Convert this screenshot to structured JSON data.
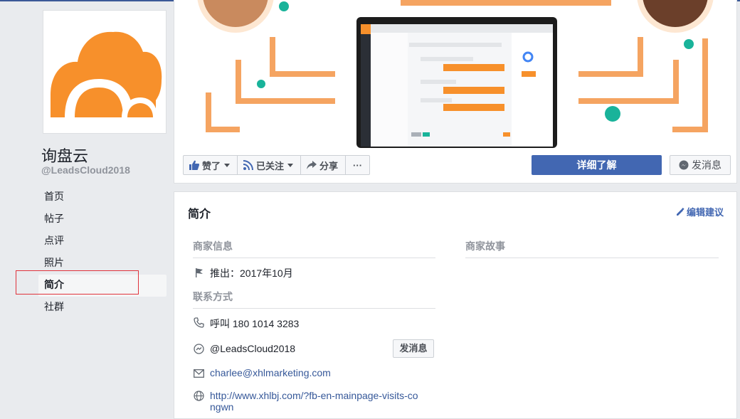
{
  "page": {
    "name": "询盘云",
    "handle": "@LeadsCloud2018"
  },
  "nav": [
    {
      "label": "首页"
    },
    {
      "label": "帖子"
    },
    {
      "label": "点评"
    },
    {
      "label": "照片"
    },
    {
      "label": "简介",
      "active": true
    },
    {
      "label": "社群"
    }
  ],
  "actions": {
    "like": "赞了",
    "follow": "已关注",
    "share": "分享",
    "more": "···",
    "learn_more": "详细了解",
    "message": "发消息"
  },
  "about": {
    "title": "简介",
    "edit": "编辑建议",
    "business_info": "商家信息",
    "launched": "推出：2017年10月",
    "contact": "联系方式",
    "phone": "呼叫 180 1014 3283",
    "messenger": "@LeadsCloud2018",
    "messenger_button": "发消息",
    "email": "charlee@xhlmarketing.com",
    "website": "http://www.xhlbj.com/?fb-en-mainpage-visits-congwn",
    "story": "商家故事"
  },
  "colors": {
    "brand_orange": "#f7902b",
    "facebook_blue": "#4267b2",
    "teal": "#19b39a"
  }
}
